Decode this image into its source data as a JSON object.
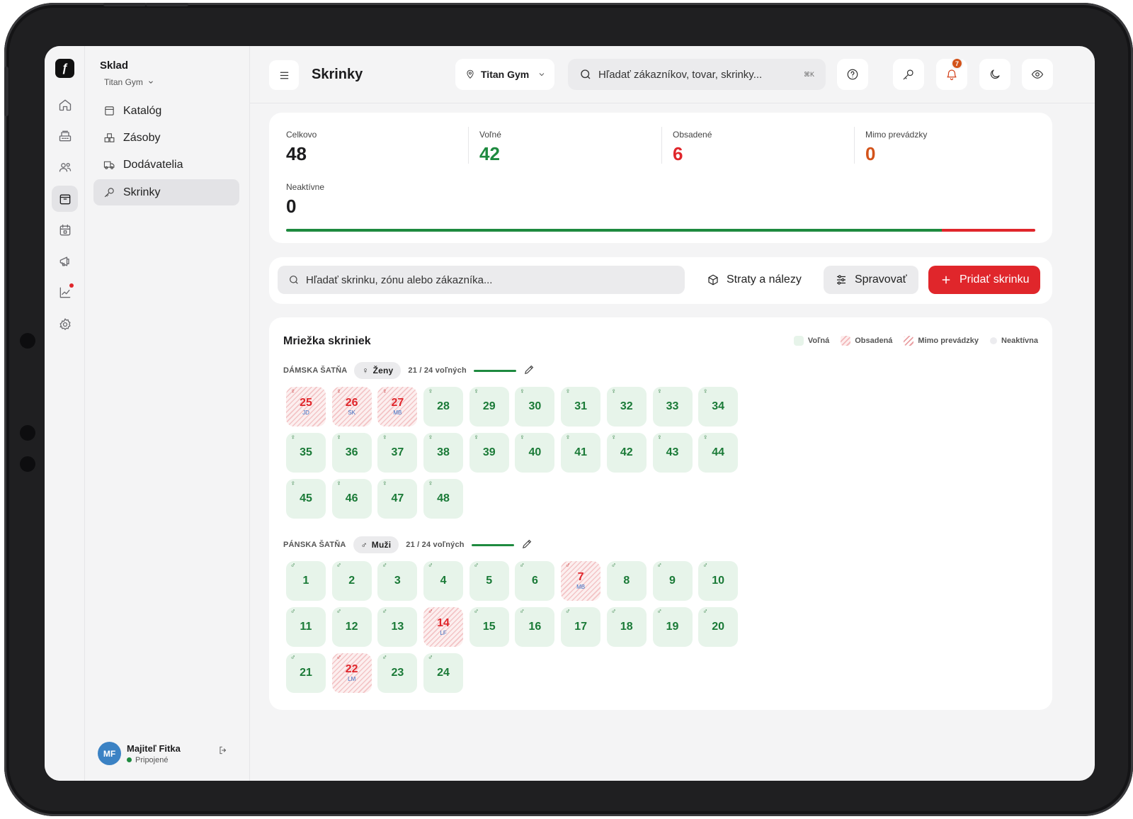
{
  "app": {
    "logo_glyph": "ƒ",
    "rail": [
      {
        "icon": "home-icon"
      },
      {
        "icon": "register-icon"
      },
      {
        "icon": "users-icon"
      },
      {
        "icon": "inventory-icon",
        "active": true
      },
      {
        "icon": "calendar-icon"
      },
      {
        "icon": "megaphone-icon"
      },
      {
        "icon": "analytics-icon",
        "dot": true
      },
      {
        "icon": "settings-icon"
      }
    ]
  },
  "sidebar": {
    "title": "Sklad",
    "subtitle": "Titan Gym",
    "items": [
      {
        "label": "Katalóg",
        "icon": "catalog-icon"
      },
      {
        "label": "Zásoby",
        "icon": "stock-icon"
      },
      {
        "label": "Dodávatelia",
        "icon": "truck-icon"
      },
      {
        "label": "Skrinky",
        "icon": "key-icon",
        "active": true
      }
    ],
    "user": {
      "initials": "MF",
      "name": "Majiteľ Fitka",
      "status": "Pripojené"
    }
  },
  "header": {
    "title": "Skrinky",
    "location": "Titan Gym",
    "search_placeholder": "Hľadať zákazníkov, tovar, skrinky...",
    "search_shortcut": "⌘K",
    "notifications": "7"
  },
  "stats": {
    "items": [
      {
        "label": "Celkovo",
        "value": "48",
        "color": "#1c1c1e"
      },
      {
        "label": "Voľné",
        "value": "42",
        "color": "#1e8a3f"
      },
      {
        "label": "Obsadené",
        "value": "6",
        "color": "#e0262b"
      },
      {
        "label": "Mimo prevádzky",
        "value": "0",
        "color": "#d3531a"
      },
      {
        "label": "Neaktívne",
        "value": "0",
        "color": "#1c1c1e"
      }
    ],
    "free_fraction": 0.875,
    "occupied_fraction": 0.125
  },
  "toolbar": {
    "search_placeholder": "Hľadať skrinku, zónu alebo zákazníka...",
    "lost_found": "Straty a nálezy",
    "manage": "Spravovať",
    "add": "Pridať skrinku"
  },
  "grid": {
    "title": "Mriežka skriniek",
    "legend": [
      "Voľná",
      "Obsadená",
      "Mimo prevádzky",
      "Neaktívna"
    ],
    "zones": [
      {
        "name": "DÁMSKA ŠATŇA",
        "gender": "Ženy",
        "symbol": "♀",
        "availability": "21 / 24 voľných",
        "lockers": [
          {
            "n": "25",
            "occ": true,
            "ini": "JD"
          },
          {
            "n": "26",
            "occ": true,
            "ini": "SK"
          },
          {
            "n": "27",
            "occ": true,
            "ini": "MB"
          },
          {
            "n": "28"
          },
          {
            "n": "29"
          },
          {
            "n": "30"
          },
          {
            "n": "31"
          },
          {
            "n": "32"
          },
          {
            "n": "33"
          },
          {
            "n": "34"
          },
          {
            "n": "35"
          },
          {
            "n": "36"
          },
          {
            "n": "37"
          },
          {
            "n": "38"
          },
          {
            "n": "39"
          },
          {
            "n": "40"
          },
          {
            "n": "41"
          },
          {
            "n": "42"
          },
          {
            "n": "43"
          },
          {
            "n": "44"
          },
          {
            "n": "45"
          },
          {
            "n": "46"
          },
          {
            "n": "47"
          },
          {
            "n": "48"
          }
        ]
      },
      {
        "name": "PÁNSKA ŠATŇA",
        "gender": "Muži",
        "symbol": "♂",
        "availability": "21 / 24 voľných",
        "lockers": [
          {
            "n": "1"
          },
          {
            "n": "2"
          },
          {
            "n": "3"
          },
          {
            "n": "4"
          },
          {
            "n": "5"
          },
          {
            "n": "6"
          },
          {
            "n": "7",
            "occ": true,
            "ini": "MB"
          },
          {
            "n": "8"
          },
          {
            "n": "9"
          },
          {
            "n": "10"
          },
          {
            "n": "11"
          },
          {
            "n": "12"
          },
          {
            "n": "13"
          },
          {
            "n": "14",
            "occ": true,
            "ini": "LF"
          },
          {
            "n": "15"
          },
          {
            "n": "16"
          },
          {
            "n": "17"
          },
          {
            "n": "18"
          },
          {
            "n": "19"
          },
          {
            "n": "20"
          },
          {
            "n": "21"
          },
          {
            "n": "22",
            "occ": true,
            "ini": "LM"
          },
          {
            "n": "23"
          },
          {
            "n": "24"
          }
        ]
      }
    ]
  }
}
